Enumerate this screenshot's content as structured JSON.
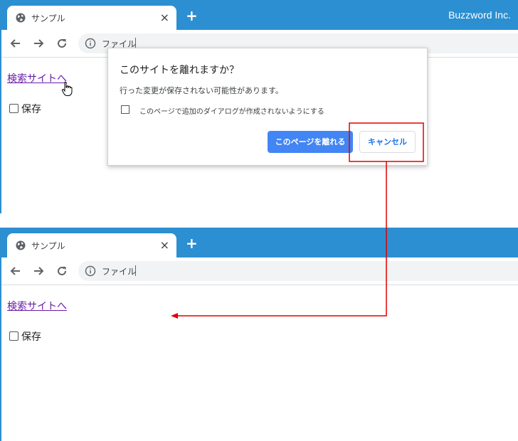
{
  "brand": "Buzzword Inc.",
  "browser": {
    "tab_title": "サンプル",
    "tab_close": "×",
    "new_tab": "+",
    "omnibox_text": "ファイル"
  },
  "page": {
    "link_label": "検索サイトへ",
    "checkbox_label": "保存"
  },
  "dialog": {
    "title": "このサイトを離れますか？",
    "message": "行った変更が保存されない可能性があります。",
    "checkbox_label": "このページで追加のダイアログが作成されないようにする",
    "leave_button": "このページを離れる",
    "cancel_button": "キャンセル"
  },
  "colors": {
    "tabstrip": "#2b8fd1",
    "leave_button": "#4285f4",
    "annotation": "#e00000"
  }
}
